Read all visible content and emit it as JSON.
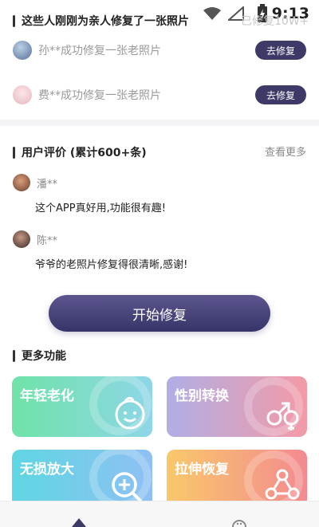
{
  "status_bar": {
    "time": "9:13",
    "icons": [
      "wifi-icon",
      "signal-icon",
      "battery-icon"
    ]
  },
  "recent_repairs": {
    "title": "这些人刚刚为亲人修复了一张照片",
    "faded_counter": "已修复10W+",
    "items": [
      {
        "text": "孙**成功修复一张老照片",
        "button": "去修复"
      },
      {
        "text": "费**成功修复一张老照片",
        "button": "去修复"
      }
    ]
  },
  "reviews": {
    "title": "用户评价 (累计600+条)",
    "more": "查看更多",
    "items": [
      {
        "name": "潘**",
        "content": "这个APP真好用,功能很有趣!"
      },
      {
        "name": "陈**",
        "content": "爷爷的老照片修复得很清晰,感谢!"
      }
    ]
  },
  "main_button": {
    "label": "开始修复"
  },
  "more_features": {
    "title": "更多功能",
    "cards": [
      {
        "label": "年轻老化",
        "icon": "baby-face-icon"
      },
      {
        "label": "性别转换",
        "icon": "gender-icon"
      },
      {
        "label": "无损放大",
        "icon": "zoom-in-icon"
      },
      {
        "label": "拉伸恢复",
        "icon": "connect-nodes-icon"
      }
    ]
  },
  "colors": {
    "primary": "#3d3a67",
    "card_green": "#7ee3b3",
    "card_pink": "#f39aa6",
    "card_blue": "#7fc8f0",
    "card_orange": "#f9a36b"
  }
}
